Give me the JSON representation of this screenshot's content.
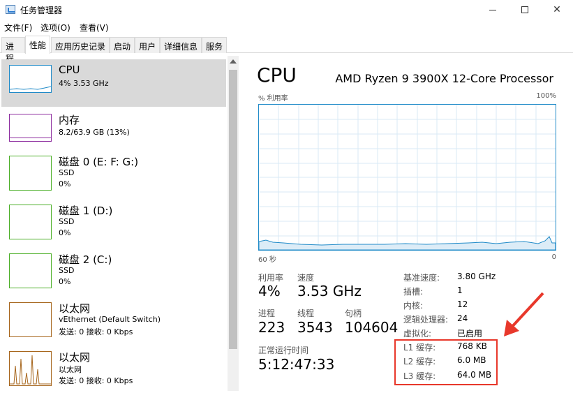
{
  "window": {
    "title": "任务管理器"
  },
  "menu": [
    "文件(F)",
    "选项(O)",
    "查看(V)"
  ],
  "tabs": [
    "进程",
    "性能",
    "应用历史记录",
    "启动",
    "用户",
    "详细信息",
    "服务"
  ],
  "sidebar": [
    {
      "name": "CPU",
      "line2": "4% 3.53 GHz",
      "line3": ""
    },
    {
      "name": "内存",
      "line2": "8.2/63.9 GB (13%)",
      "line3": ""
    },
    {
      "name": "磁盘 0 (E: F: G:)",
      "line2": "SSD",
      "line3": "0%"
    },
    {
      "name": "磁盘 1 (D:)",
      "line2": "SSD",
      "line3": "0%"
    },
    {
      "name": "磁盘 2 (C:)",
      "line2": "SSD",
      "line3": "0%"
    },
    {
      "name": "以太网",
      "line2": "vEthernet (Default Switch)",
      "line3": "发送: 0 接收: 0 Kbps"
    },
    {
      "name": "以太网",
      "line2": "以太网",
      "line3": "发送: 0 接收: 0 Kbps"
    }
  ],
  "main": {
    "title": "CPU",
    "model": "AMD Ryzen 9 3900X 12-Core Processor",
    "graph_ylabel": "% 利用率",
    "graph_ymax": "100%",
    "graph_xleft": "60 秒",
    "graph_xright": "0",
    "utilization_label": "利用率",
    "utilization": "4%",
    "speed_label": "速度",
    "speed": "3.53 GHz",
    "processes_label": "进程",
    "processes": "223",
    "threads_label": "线程",
    "threads": "3543",
    "handles_label": "句柄",
    "handles": "104604",
    "uptime_label": "正常运行时间",
    "uptime": "5:12:47:33",
    "specs": [
      {
        "k": "基准速度:",
        "v": "3.80 GHz"
      },
      {
        "k": "插槽:",
        "v": "1"
      },
      {
        "k": "内核:",
        "v": "12"
      },
      {
        "k": "逻辑处理器:",
        "v": "24"
      },
      {
        "k": "虚拟化:",
        "v": "已启用"
      },
      {
        "k": "L1 缓存:",
        "v": "768 KB"
      },
      {
        "k": "L2 缓存:",
        "v": "6.0 MB"
      },
      {
        "k": "L3 缓存:",
        "v": "64.0 MB"
      }
    ]
  },
  "colors": {
    "cpu": "#1f8ac8",
    "memory": "#8e2fa0",
    "disk": "#4caf28",
    "network": "#a6651b",
    "annotation": "#e8382b"
  },
  "icons": {
    "app": "task-manager-icon",
    "minimize": "minimize-icon",
    "maximize": "maximize-icon",
    "close": "close-icon"
  }
}
